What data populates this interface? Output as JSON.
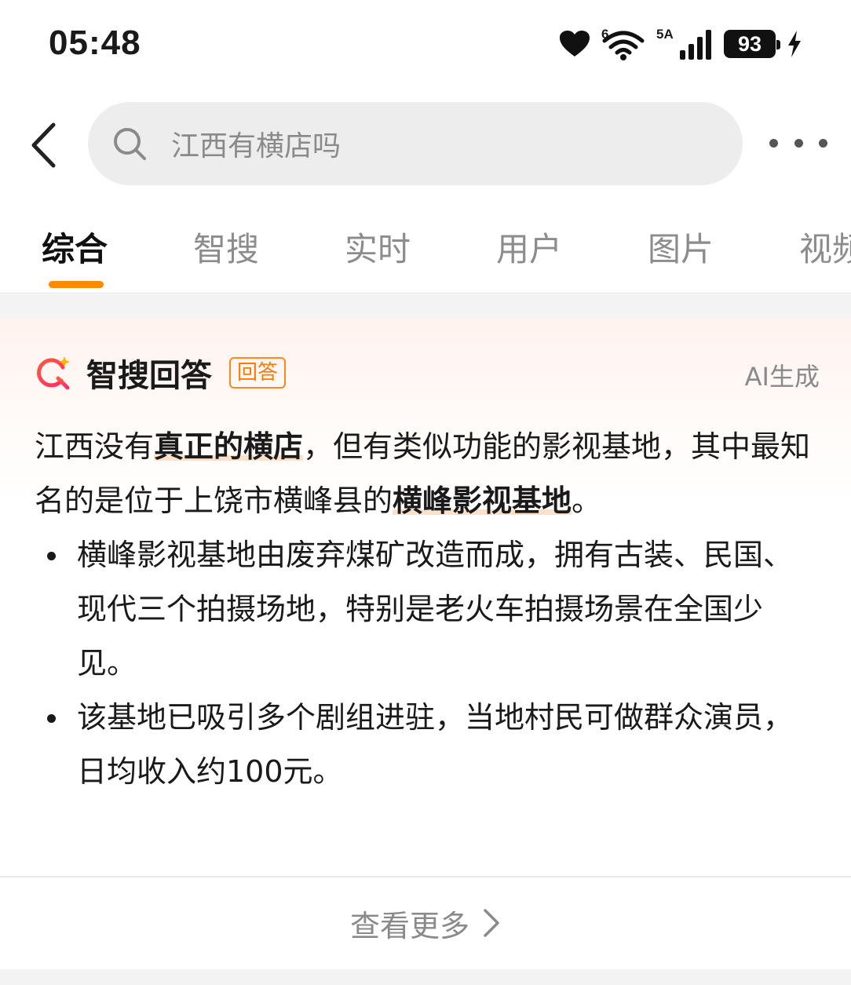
{
  "status_bar": {
    "time": "05:48",
    "wifi_label": "6",
    "network_label": "5A",
    "battery": "93"
  },
  "search": {
    "query": "江西有横店吗"
  },
  "tabs": [
    {
      "label": "综合"
    },
    {
      "label": "智搜"
    },
    {
      "label": "实时"
    },
    {
      "label": "用户"
    },
    {
      "label": "图片"
    },
    {
      "label": "视频"
    }
  ],
  "answer_card": {
    "title": "智搜回答",
    "badge": "回答",
    "ai_tag": "AI生成",
    "p1_a": "江西没有",
    "p1_hl1": "真正的横店",
    "p1_b": "，但有类似功能的影视基地，其中最知名的是位于上饶市横峰县的",
    "p1_hl2": "横峰影视基地",
    "p1_c": "。",
    "bullets": [
      "横峰影视基地由废弃煤矿改造而成，拥有古装、民国、现代三个拍摄场地，特别是老火车拍摄场景在全国少见。",
      "该基地已吸引多个剧组进驻，当地村民可做群众演员，日均收入约100元。"
    ]
  },
  "see_more": "查看更多",
  "colors": {
    "accent": "#ff8a00",
    "highlight_underline": "#ffe0c8",
    "search_bg": "#ededed"
  }
}
